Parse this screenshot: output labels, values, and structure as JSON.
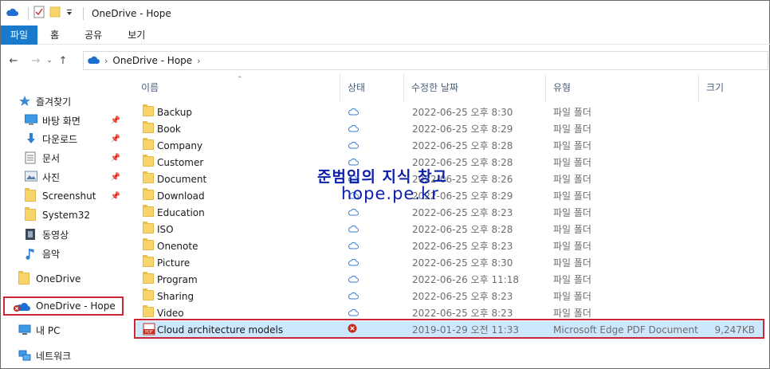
{
  "window": {
    "title": "OneDrive - Hope"
  },
  "ribbon": {
    "tabs": [
      "파일",
      "홈",
      "공유",
      "보기"
    ]
  },
  "address": {
    "crumbs": [
      "OneDrive - Hope"
    ]
  },
  "nav": {
    "quick_access": "즐겨찾기",
    "items": [
      {
        "label": "바탕 화면",
        "pinned": true
      },
      {
        "label": "다운로드",
        "pinned": true
      },
      {
        "label": "문서",
        "pinned": true
      },
      {
        "label": "사진",
        "pinned": true
      },
      {
        "label": "Screenshut",
        "pinned": true
      },
      {
        "label": "System32",
        "pinned": false
      },
      {
        "label": "동영상",
        "pinned": false
      },
      {
        "label": "음악",
        "pinned": false
      }
    ],
    "onedrive": "OneDrive",
    "onedrive_hope": "OneDrive - Hope",
    "this_pc": "내 PC",
    "network": "네트워크"
  },
  "columns": {
    "name": "이름",
    "status": "상태",
    "modified": "수정한 날짜",
    "type": "유형",
    "size": "크기"
  },
  "files": [
    {
      "name": "Backup",
      "date": "2022-06-25 오후 8:30",
      "type": "파일 폴더",
      "size": ""
    },
    {
      "name": "Book",
      "date": "2022-06-25 오후 8:29",
      "type": "파일 폴더",
      "size": ""
    },
    {
      "name": "Company",
      "date": "2022-06-25 오후 8:28",
      "type": "파일 폴더",
      "size": ""
    },
    {
      "name": "Customer",
      "date": "2022-06-25 오후 8:28",
      "type": "파일 폴더",
      "size": ""
    },
    {
      "name": "Document",
      "date": "2022-06-25 오후 8:26",
      "type": "파일 폴더",
      "size": ""
    },
    {
      "name": "Download",
      "date": "2022-06-25 오후 8:29",
      "type": "파일 폴더",
      "size": ""
    },
    {
      "name": "Education",
      "date": "2022-06-25 오후 8:23",
      "type": "파일 폴더",
      "size": ""
    },
    {
      "name": "ISO",
      "date": "2022-06-25 오후 8:28",
      "type": "파일 폴더",
      "size": ""
    },
    {
      "name": "Onenote",
      "date": "2022-06-25 오후 8:23",
      "type": "파일 폴더",
      "size": ""
    },
    {
      "name": "Picture",
      "date": "2022-06-25 오후 8:30",
      "type": "파일 폴더",
      "size": ""
    },
    {
      "name": "Program",
      "date": "2022-06-26 오후 11:18",
      "type": "파일 폴더",
      "size": ""
    },
    {
      "name": "Sharing",
      "date": "2022-06-25 오후 8:23",
      "type": "파일 폴더",
      "size": ""
    },
    {
      "name": "Video",
      "date": "2022-06-25 오후 8:23",
      "type": "파일 폴더",
      "size": ""
    },
    {
      "name": "Cloud architecture models",
      "date": "2019-01-29 오전 11:33",
      "type": "Microsoft Edge PDF Document",
      "size": "9,247KB"
    }
  ],
  "watermark": {
    "line1": "준범입의 지식 창고",
    "line2": "hope.pe.kr"
  },
  "colors": {
    "accent": "#1979ca",
    "highlight_border": "#c8283a",
    "cloud": "#3a7bd5",
    "error": "#c42b1c",
    "selected_row": "#cce8ff"
  }
}
